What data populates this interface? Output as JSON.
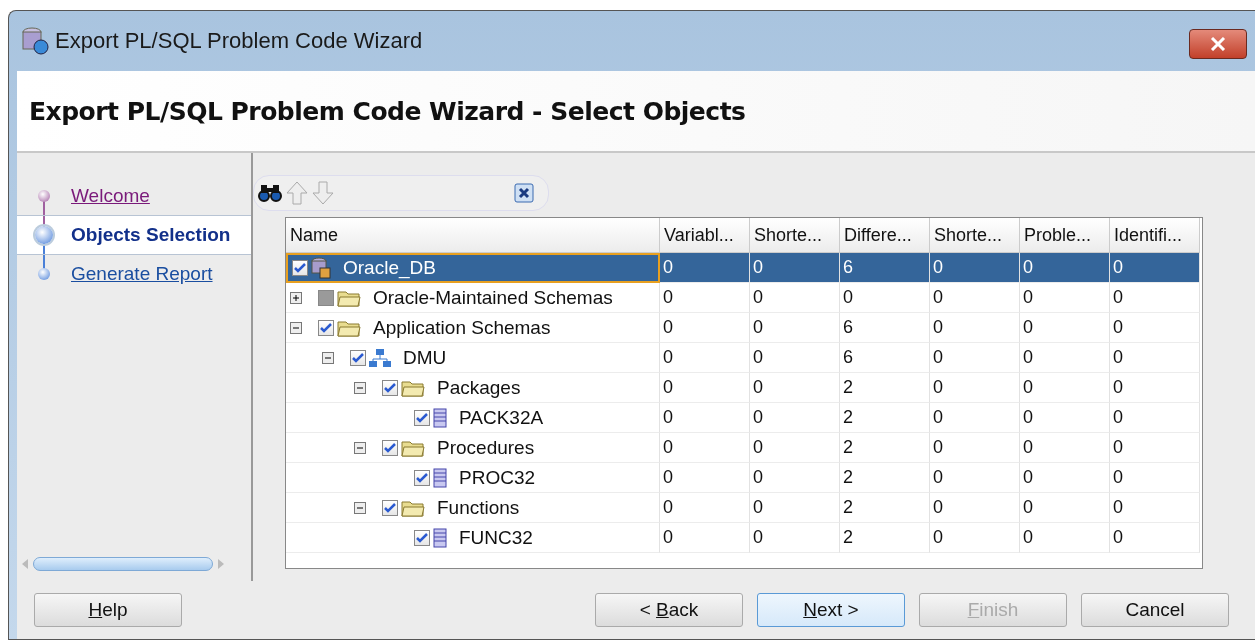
{
  "window": {
    "title": "Export PL/SQL Problem Code Wizard"
  },
  "header": {
    "title": "Export PL/SQL Problem Code Wizard - Select Objects"
  },
  "steps": [
    {
      "label": "Welcome",
      "visited": true,
      "selected": false
    },
    {
      "label": "Objects Selection",
      "visited": false,
      "selected": true
    },
    {
      "label": "Generate Report",
      "visited": false,
      "selected": false
    }
  ],
  "table": {
    "columns": [
      "Name",
      "Variabl...",
      "Shorte...",
      "Differe...",
      "Shorte...",
      "Proble...",
      "Identifi..."
    ],
    "rows": [
      {
        "kind": "database",
        "name": "Oracle_DB",
        "checked": true,
        "disabled": false,
        "selected": true,
        "values": [
          "0",
          "0",
          "6",
          "0",
          "0",
          "0"
        ],
        "children": [
          {
            "kind": "folder",
            "name": "Oracle-Maintained Schemas",
            "checked": false,
            "disabled": true,
            "selected": false,
            "expanded": false,
            "values": [
              "0",
              "0",
              "0",
              "0",
              "0",
              "0"
            ]
          },
          {
            "kind": "folder",
            "name": "Application Schemas",
            "checked": true,
            "disabled": false,
            "selected": false,
            "expanded": true,
            "values": [
              "0",
              "0",
              "6",
              "0",
              "0",
              "0"
            ],
            "children": [
              {
                "kind": "schema",
                "name": "DMU",
                "checked": true,
                "disabled": false,
                "selected": false,
                "expanded": true,
                "values": [
                  "0",
                  "0",
                  "6",
                  "0",
                  "0",
                  "0"
                ],
                "children": [
                  {
                    "kind": "folder",
                    "name": "Packages",
                    "checked": true,
                    "disabled": false,
                    "selected": false,
                    "expanded": true,
                    "values": [
                      "0",
                      "0",
                      "2",
                      "0",
                      "0",
                      "0"
                    ],
                    "children": [
                      {
                        "kind": "object",
                        "name": "PACK32A",
                        "checked": true,
                        "disabled": false,
                        "selected": false,
                        "values": [
                          "0",
                          "0",
                          "2",
                          "0",
                          "0",
                          "0"
                        ]
                      }
                    ]
                  },
                  {
                    "kind": "folder",
                    "name": "Procedures",
                    "checked": true,
                    "disabled": false,
                    "selected": false,
                    "expanded": true,
                    "values": [
                      "0",
                      "0",
                      "2",
                      "0",
                      "0",
                      "0"
                    ],
                    "children": [
                      {
                        "kind": "object",
                        "name": "PROC32",
                        "checked": true,
                        "disabled": false,
                        "selected": false,
                        "values": [
                          "0",
                          "0",
                          "2",
                          "0",
                          "0",
                          "0"
                        ]
                      }
                    ]
                  },
                  {
                    "kind": "folder",
                    "name": "Functions",
                    "checked": true,
                    "disabled": false,
                    "selected": false,
                    "expanded": true,
                    "values": [
                      "0",
                      "0",
                      "2",
                      "0",
                      "0",
                      "0"
                    ],
                    "children": [
                      {
                        "kind": "object",
                        "name": "FUNC32",
                        "checked": true,
                        "disabled": false,
                        "selected": false,
                        "values": [
                          "0",
                          "0",
                          "2",
                          "0",
                          "0",
                          "0"
                        ]
                      }
                    ]
                  }
                ]
              }
            ]
          }
        ]
      }
    ]
  },
  "buttons": [
    {
      "key": "H",
      "after": "elp",
      "disabled": false,
      "focused": false
    },
    {
      "before": "< ",
      "key": "B",
      "after": "ack",
      "disabled": false,
      "focused": false
    },
    {
      "key": "N",
      "after": "ext >",
      "disabled": false,
      "focused": true
    },
    {
      "key": "F",
      "after": "inish",
      "disabled": true,
      "focused": false
    },
    {
      "before": "Cancel",
      "disabled": false,
      "focused": false
    }
  ]
}
